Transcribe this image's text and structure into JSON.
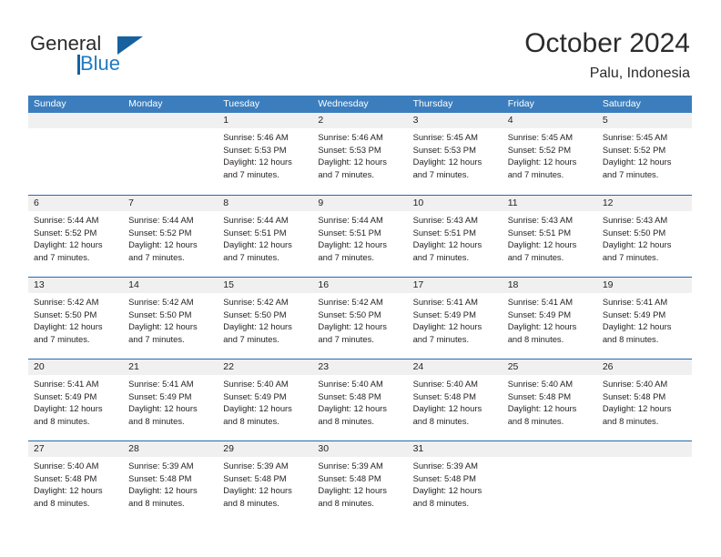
{
  "brand": {
    "name_part1": "General",
    "name_part2": "Blue",
    "accent_color": "#16619e",
    "logo_icon": "triangle-logo-icon"
  },
  "header": {
    "title": "October 2024",
    "subtitle": "Palu, Indonesia"
  },
  "theme": {
    "header_blue": "#3c7ebd",
    "row_rule_blue": "#1f6db5",
    "day_band_gray": "#f0f0f0",
    "text_color": "#231f20"
  },
  "weekdays": [
    "Sunday",
    "Monday",
    "Tuesday",
    "Wednesday",
    "Thursday",
    "Friday",
    "Saturday"
  ],
  "weeks": [
    [
      {
        "day": "",
        "sunrise": "",
        "sunset": "",
        "daylight1": "",
        "daylight2": ""
      },
      {
        "day": "",
        "sunrise": "",
        "sunset": "",
        "daylight1": "",
        "daylight2": ""
      },
      {
        "day": "1",
        "sunrise": "Sunrise: 5:46 AM",
        "sunset": "Sunset: 5:53 PM",
        "daylight1": "Daylight: 12 hours",
        "daylight2": "and 7 minutes."
      },
      {
        "day": "2",
        "sunrise": "Sunrise: 5:46 AM",
        "sunset": "Sunset: 5:53 PM",
        "daylight1": "Daylight: 12 hours",
        "daylight2": "and 7 minutes."
      },
      {
        "day": "3",
        "sunrise": "Sunrise: 5:45 AM",
        "sunset": "Sunset: 5:53 PM",
        "daylight1": "Daylight: 12 hours",
        "daylight2": "and 7 minutes."
      },
      {
        "day": "4",
        "sunrise": "Sunrise: 5:45 AM",
        "sunset": "Sunset: 5:52 PM",
        "daylight1": "Daylight: 12 hours",
        "daylight2": "and 7 minutes."
      },
      {
        "day": "5",
        "sunrise": "Sunrise: 5:45 AM",
        "sunset": "Sunset: 5:52 PM",
        "daylight1": "Daylight: 12 hours",
        "daylight2": "and 7 minutes."
      }
    ],
    [
      {
        "day": "6",
        "sunrise": "Sunrise: 5:44 AM",
        "sunset": "Sunset: 5:52 PM",
        "daylight1": "Daylight: 12 hours",
        "daylight2": "and 7 minutes."
      },
      {
        "day": "7",
        "sunrise": "Sunrise: 5:44 AM",
        "sunset": "Sunset: 5:52 PM",
        "daylight1": "Daylight: 12 hours",
        "daylight2": "and 7 minutes."
      },
      {
        "day": "8",
        "sunrise": "Sunrise: 5:44 AM",
        "sunset": "Sunset: 5:51 PM",
        "daylight1": "Daylight: 12 hours",
        "daylight2": "and 7 minutes."
      },
      {
        "day": "9",
        "sunrise": "Sunrise: 5:44 AM",
        "sunset": "Sunset: 5:51 PM",
        "daylight1": "Daylight: 12 hours",
        "daylight2": "and 7 minutes."
      },
      {
        "day": "10",
        "sunrise": "Sunrise: 5:43 AM",
        "sunset": "Sunset: 5:51 PM",
        "daylight1": "Daylight: 12 hours",
        "daylight2": "and 7 minutes."
      },
      {
        "day": "11",
        "sunrise": "Sunrise: 5:43 AM",
        "sunset": "Sunset: 5:51 PM",
        "daylight1": "Daylight: 12 hours",
        "daylight2": "and 7 minutes."
      },
      {
        "day": "12",
        "sunrise": "Sunrise: 5:43 AM",
        "sunset": "Sunset: 5:50 PM",
        "daylight1": "Daylight: 12 hours",
        "daylight2": "and 7 minutes."
      }
    ],
    [
      {
        "day": "13",
        "sunrise": "Sunrise: 5:42 AM",
        "sunset": "Sunset: 5:50 PM",
        "daylight1": "Daylight: 12 hours",
        "daylight2": "and 7 minutes."
      },
      {
        "day": "14",
        "sunrise": "Sunrise: 5:42 AM",
        "sunset": "Sunset: 5:50 PM",
        "daylight1": "Daylight: 12 hours",
        "daylight2": "and 7 minutes."
      },
      {
        "day": "15",
        "sunrise": "Sunrise: 5:42 AM",
        "sunset": "Sunset: 5:50 PM",
        "daylight1": "Daylight: 12 hours",
        "daylight2": "and 7 minutes."
      },
      {
        "day": "16",
        "sunrise": "Sunrise: 5:42 AM",
        "sunset": "Sunset: 5:50 PM",
        "daylight1": "Daylight: 12 hours",
        "daylight2": "and 7 minutes."
      },
      {
        "day": "17",
        "sunrise": "Sunrise: 5:41 AM",
        "sunset": "Sunset: 5:49 PM",
        "daylight1": "Daylight: 12 hours",
        "daylight2": "and 7 minutes."
      },
      {
        "day": "18",
        "sunrise": "Sunrise: 5:41 AM",
        "sunset": "Sunset: 5:49 PM",
        "daylight1": "Daylight: 12 hours",
        "daylight2": "and 8 minutes."
      },
      {
        "day": "19",
        "sunrise": "Sunrise: 5:41 AM",
        "sunset": "Sunset: 5:49 PM",
        "daylight1": "Daylight: 12 hours",
        "daylight2": "and 8 minutes."
      }
    ],
    [
      {
        "day": "20",
        "sunrise": "Sunrise: 5:41 AM",
        "sunset": "Sunset: 5:49 PM",
        "daylight1": "Daylight: 12 hours",
        "daylight2": "and 8 minutes."
      },
      {
        "day": "21",
        "sunrise": "Sunrise: 5:41 AM",
        "sunset": "Sunset: 5:49 PM",
        "daylight1": "Daylight: 12 hours",
        "daylight2": "and 8 minutes."
      },
      {
        "day": "22",
        "sunrise": "Sunrise: 5:40 AM",
        "sunset": "Sunset: 5:49 PM",
        "daylight1": "Daylight: 12 hours",
        "daylight2": "and 8 minutes."
      },
      {
        "day": "23",
        "sunrise": "Sunrise: 5:40 AM",
        "sunset": "Sunset: 5:48 PM",
        "daylight1": "Daylight: 12 hours",
        "daylight2": "and 8 minutes."
      },
      {
        "day": "24",
        "sunrise": "Sunrise: 5:40 AM",
        "sunset": "Sunset: 5:48 PM",
        "daylight1": "Daylight: 12 hours",
        "daylight2": "and 8 minutes."
      },
      {
        "day": "25",
        "sunrise": "Sunrise: 5:40 AM",
        "sunset": "Sunset: 5:48 PM",
        "daylight1": "Daylight: 12 hours",
        "daylight2": "and 8 minutes."
      },
      {
        "day": "26",
        "sunrise": "Sunrise: 5:40 AM",
        "sunset": "Sunset: 5:48 PM",
        "daylight1": "Daylight: 12 hours",
        "daylight2": "and 8 minutes."
      }
    ],
    [
      {
        "day": "27",
        "sunrise": "Sunrise: 5:40 AM",
        "sunset": "Sunset: 5:48 PM",
        "daylight1": "Daylight: 12 hours",
        "daylight2": "and 8 minutes."
      },
      {
        "day": "28",
        "sunrise": "Sunrise: 5:39 AM",
        "sunset": "Sunset: 5:48 PM",
        "daylight1": "Daylight: 12 hours",
        "daylight2": "and 8 minutes."
      },
      {
        "day": "29",
        "sunrise": "Sunrise: 5:39 AM",
        "sunset": "Sunset: 5:48 PM",
        "daylight1": "Daylight: 12 hours",
        "daylight2": "and 8 minutes."
      },
      {
        "day": "30",
        "sunrise": "Sunrise: 5:39 AM",
        "sunset": "Sunset: 5:48 PM",
        "daylight1": "Daylight: 12 hours",
        "daylight2": "and 8 minutes."
      },
      {
        "day": "31",
        "sunrise": "Sunrise: 5:39 AM",
        "sunset": "Sunset: 5:48 PM",
        "daylight1": "Daylight: 12 hours",
        "daylight2": "and 8 minutes."
      },
      {
        "day": "",
        "sunrise": "",
        "sunset": "",
        "daylight1": "",
        "daylight2": ""
      },
      {
        "day": "",
        "sunrise": "",
        "sunset": "",
        "daylight1": "",
        "daylight2": ""
      }
    ]
  ]
}
